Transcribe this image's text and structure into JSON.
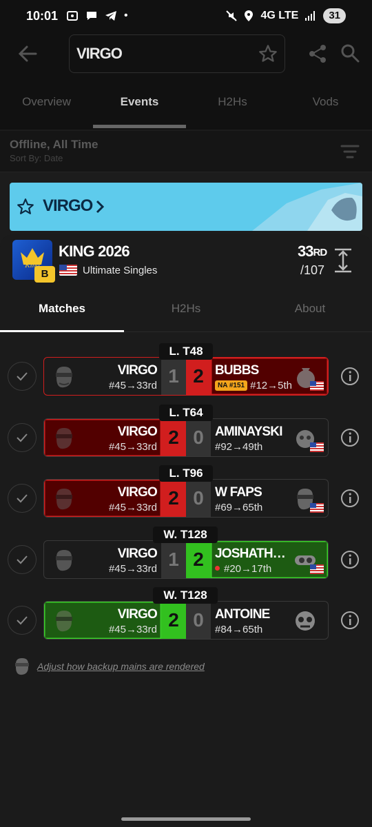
{
  "status": {
    "time": "10:01",
    "network": "4G LTE",
    "battery": "31"
  },
  "appbar": {
    "query": "VIRGO"
  },
  "top_tabs": [
    "Overview",
    "Events",
    "H2Hs",
    "Vods"
  ],
  "filter": {
    "title": "Offline, All Time",
    "sort": "Sort By: Date"
  },
  "banner": {
    "name": "VIRGO"
  },
  "tournament": {
    "name": "KING 2026",
    "badge": "B",
    "game": "Ultimate Singles",
    "placing": "33",
    "placing_suffix": "RD",
    "entrants": "/107"
  },
  "inner_tabs": [
    "Matches",
    "H2Hs",
    "About"
  ],
  "matches": [
    {
      "round": "L. T48",
      "p1": "VIRGO",
      "p1_seed": "#45→33rd",
      "s1": "1",
      "s2": "2",
      "p2": "BUBBS",
      "p2_tag": "NA #151",
      "p2_seed": "#12→5th"
    },
    {
      "round": "L. T64",
      "p1": "VIRGO",
      "p1_seed": "#45→33rd",
      "s1": "2",
      "s2": "0",
      "p2": "AMINAYSKI",
      "p2_seed": "#92→49th"
    },
    {
      "round": "L. T96",
      "p1": "VIRGO",
      "p1_seed": "#45→33rd",
      "s1": "2",
      "s2": "0",
      "p2": "W FAPS",
      "p2_seed": "#69→65th"
    },
    {
      "round": "W. T128",
      "p1": "VIRGO",
      "p1_seed": "#45→33rd",
      "s1": "1",
      "s2": "2",
      "p2": "JOSHATHAN GA...",
      "p2_seed": "#20→17th"
    },
    {
      "round": "W. T128",
      "p1": "VIRGO",
      "p1_seed": "#45→33rd",
      "s1": "2",
      "s2": "0",
      "p2": "ANTOINE",
      "p2_seed": "#84→65th"
    }
  ],
  "footnote": "Adjust how backup mains are rendered",
  "colors": {
    "loss_red": "#d11e1e",
    "win_green": "#32c01f",
    "banner": "#5ecbec"
  },
  "icons": [
    "back-arrow-icon",
    "star-icon",
    "share-icon",
    "search-icon",
    "sort-icon",
    "chevron-right-icon",
    "expand-icon",
    "check-icon",
    "info-icon",
    "us-flag-icon"
  ]
}
